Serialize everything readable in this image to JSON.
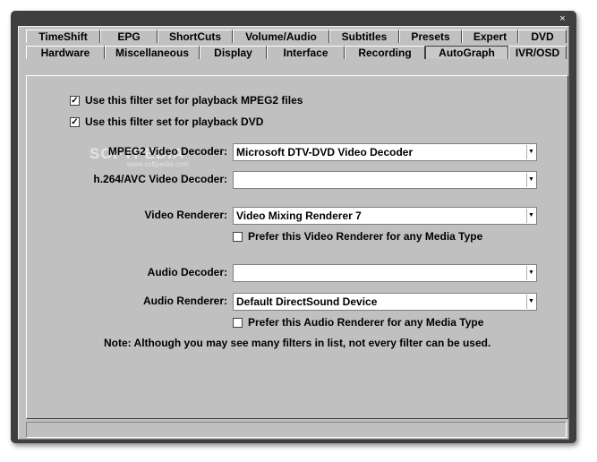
{
  "window": {
    "close_label": "×"
  },
  "tabs_row1": [
    "TimeShift",
    "EPG",
    "ShortCuts",
    "Volume/Audio",
    "Subtitles",
    "Presets",
    "Expert",
    "DVD"
  ],
  "tabs_row2": [
    "Hardware",
    "Miscellaneous",
    "Display",
    "Interface",
    "Recording",
    "AutoGraph",
    "IVR/OSD"
  ],
  "active_tab": "AutoGraph",
  "watermark": {
    "text": "SOFTPEDIA",
    "url": "www.softpedia.com"
  },
  "checks": {
    "mpeg2": {
      "label": "Use this filter set for playback MPEG2 files",
      "checked": true
    },
    "dvd": {
      "label": "Use this filter set for playback DVD",
      "checked": true
    },
    "prefer_video": {
      "label": "Prefer this Video Renderer for any Media Type",
      "checked": false
    },
    "prefer_audio": {
      "label": "Prefer this Audio Renderer for any Media Type",
      "checked": false
    }
  },
  "fields": {
    "mpeg2_decoder": {
      "label": "MPEG2 Video Decoder:",
      "value": "Microsoft DTV-DVD Video Decoder"
    },
    "h264_decoder": {
      "label": "h.264/AVC Video Decoder:",
      "value": ""
    },
    "video_renderer": {
      "label": "Video Renderer:",
      "value": "Video Mixing Renderer 7"
    },
    "audio_decoder": {
      "label": "Audio Decoder:",
      "value": ""
    },
    "audio_renderer": {
      "label": "Audio Renderer:",
      "value": "Default DirectSound Device"
    }
  },
  "note": "Note: Although you may see many filters in list, not every filter can be used.",
  "colors": {
    "frame": "#3f3f3f",
    "face": "#c0c0c0"
  }
}
